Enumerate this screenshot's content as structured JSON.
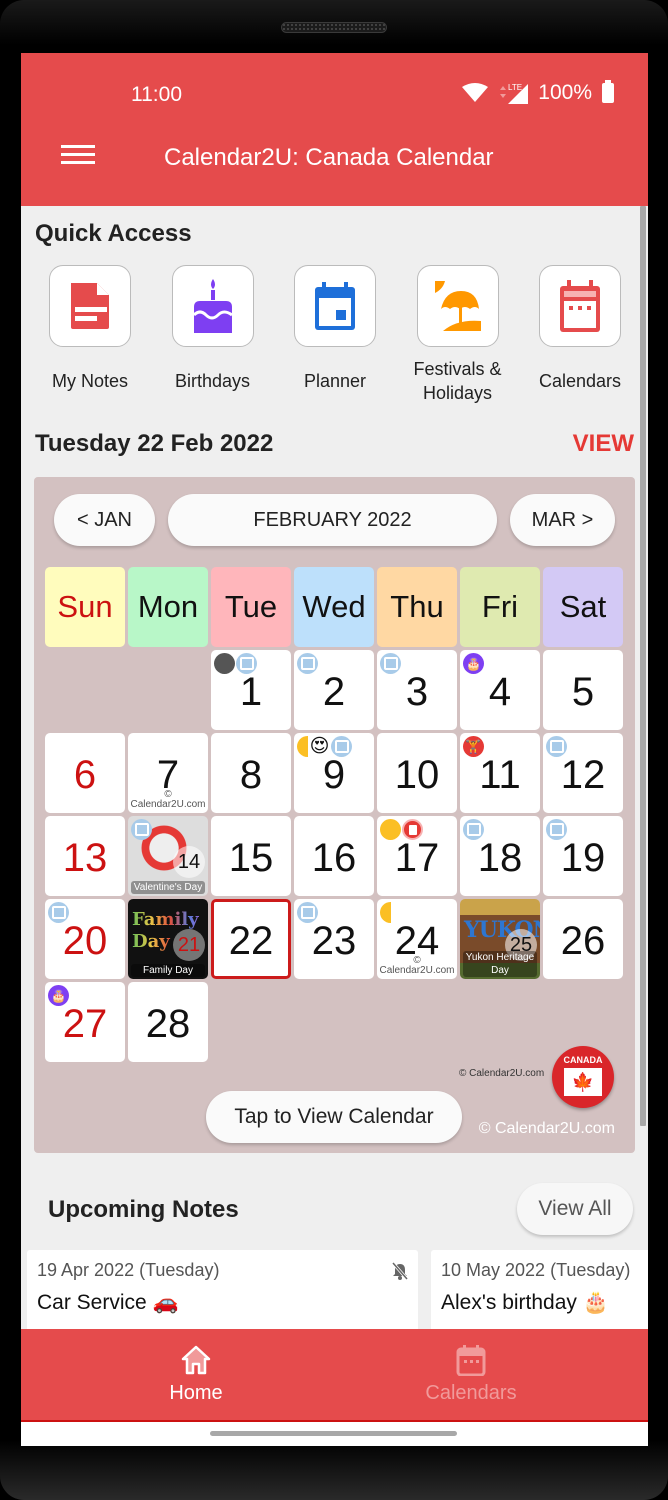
{
  "status_bar": {
    "time": "11:00",
    "network": "LTE",
    "battery": "100%"
  },
  "app_bar": {
    "title": "Calendar2U: Canada Calendar"
  },
  "quick_access": {
    "title": "Quick Access",
    "items": [
      {
        "label": "My Notes",
        "icon": "notes-icon",
        "color": "#e54b4c"
      },
      {
        "label": "Birthdays",
        "icon": "birthday-cake-icon",
        "color": "#7e3ff2"
      },
      {
        "label": "Planner",
        "icon": "planner-calendar-icon",
        "color": "#1e6fd9"
      },
      {
        "label": "Festivals & Holidays",
        "icon": "beach-umbrella-icon",
        "color": "#ff9800"
      },
      {
        "label": "Calendars",
        "icon": "calendar-icon",
        "color": "#e54b4c"
      }
    ]
  },
  "today": {
    "heading": "Tuesday 22 Feb 2022",
    "view_label": "VIEW"
  },
  "calendar": {
    "prev_label": "< JAN",
    "month_label": "FEBRUARY 2022",
    "next_label": "MAR >",
    "weekdays": [
      {
        "label": "Sun",
        "color": "#fffcbd",
        "text": "#cc1111"
      },
      {
        "label": "Mon",
        "color": "#b8f7c8",
        "text": "#111111"
      },
      {
        "label": "Tue",
        "color": "#ffb6bb",
        "text": "#111111"
      },
      {
        "label": "Wed",
        "color": "#bde0fb",
        "text": "#111111"
      },
      {
        "label": "Thu",
        "color": "#ffd8a3",
        "text": "#111111"
      },
      {
        "label": "Fri",
        "color": "#dfeab0",
        "text": "#111111"
      },
      {
        "label": "Sat",
        "color": "#d3c9f5",
        "text": "#111111"
      }
    ],
    "leading_blanks": 2,
    "days": [
      {
        "n": "1",
        "badges": [
          "new-moon",
          "planner"
        ]
      },
      {
        "n": "2",
        "badges": [
          "planner"
        ]
      },
      {
        "n": "3",
        "badges": [
          "planner"
        ]
      },
      {
        "n": "4",
        "badges": [
          "birthday"
        ]
      },
      {
        "n": "5",
        "badges": []
      },
      {
        "n": "6",
        "badges": [],
        "sunday": true
      },
      {
        "n": "7",
        "badges": [],
        "watermark": "©\nCalendar2U.com"
      },
      {
        "n": "8",
        "badges": []
      },
      {
        "n": "9",
        "badges": [
          "first-quarter-moon",
          "heart-eyes-emoji",
          "planner"
        ]
      },
      {
        "n": "10",
        "badges": []
      },
      {
        "n": "11",
        "badges": [
          "weightlifter-emoji"
        ]
      },
      {
        "n": "12",
        "badges": [
          "planner"
        ]
      },
      {
        "n": "13",
        "badges": [],
        "sunday": true
      },
      {
        "n": "14",
        "badges": [
          "planner"
        ],
        "holiday": "Valentine's Day",
        "holiday_style": "val"
      },
      {
        "n": "15",
        "badges": []
      },
      {
        "n": "16",
        "badges": []
      },
      {
        "n": "17",
        "badges": [
          "full-moon",
          "note"
        ]
      },
      {
        "n": "18",
        "badges": [
          "planner"
        ]
      },
      {
        "n": "19",
        "badges": [
          "planner"
        ]
      },
      {
        "n": "20",
        "badges": [
          "planner"
        ],
        "sunday": true
      },
      {
        "n": "21",
        "badges": [],
        "holiday": "Family Day",
        "holiday_style": "fam",
        "art": "Family Day"
      },
      {
        "n": "22",
        "badges": [],
        "today": true
      },
      {
        "n": "23",
        "badges": [
          "planner"
        ]
      },
      {
        "n": "24",
        "badges": [
          "last-quarter-moon"
        ],
        "watermark": "©\nCalendar2U.com"
      },
      {
        "n": "25",
        "badges": [],
        "holiday": "Yukon Heritage Day",
        "holiday_style": "yuk",
        "art": "YUKON"
      },
      {
        "n": "26",
        "badges": []
      },
      {
        "n": "27",
        "badges": [
          "birthday"
        ],
        "sunday": true
      },
      {
        "n": "28",
        "badges": []
      }
    ],
    "inline_watermark": "© Calendar2U.com",
    "logo_text": "CANADA",
    "copyright": "© Calendar2U.com",
    "tap_label": "Tap to View Calendar"
  },
  "upcoming": {
    "title": "Upcoming Notes",
    "view_all_label": "View All",
    "notes": [
      {
        "date": "19 Apr 2022 (Tuesday)",
        "text": "Car Service 🚗",
        "alarm": "off"
      },
      {
        "date": "10 May 2022 (Tuesday)",
        "text": "Alex's birthday 🎂"
      }
    ]
  },
  "bottom_nav": {
    "items": [
      {
        "label": "Home",
        "icon": "home-icon",
        "active": true
      },
      {
        "label": "Calendars",
        "icon": "calendar-icon",
        "active": false
      }
    ]
  }
}
